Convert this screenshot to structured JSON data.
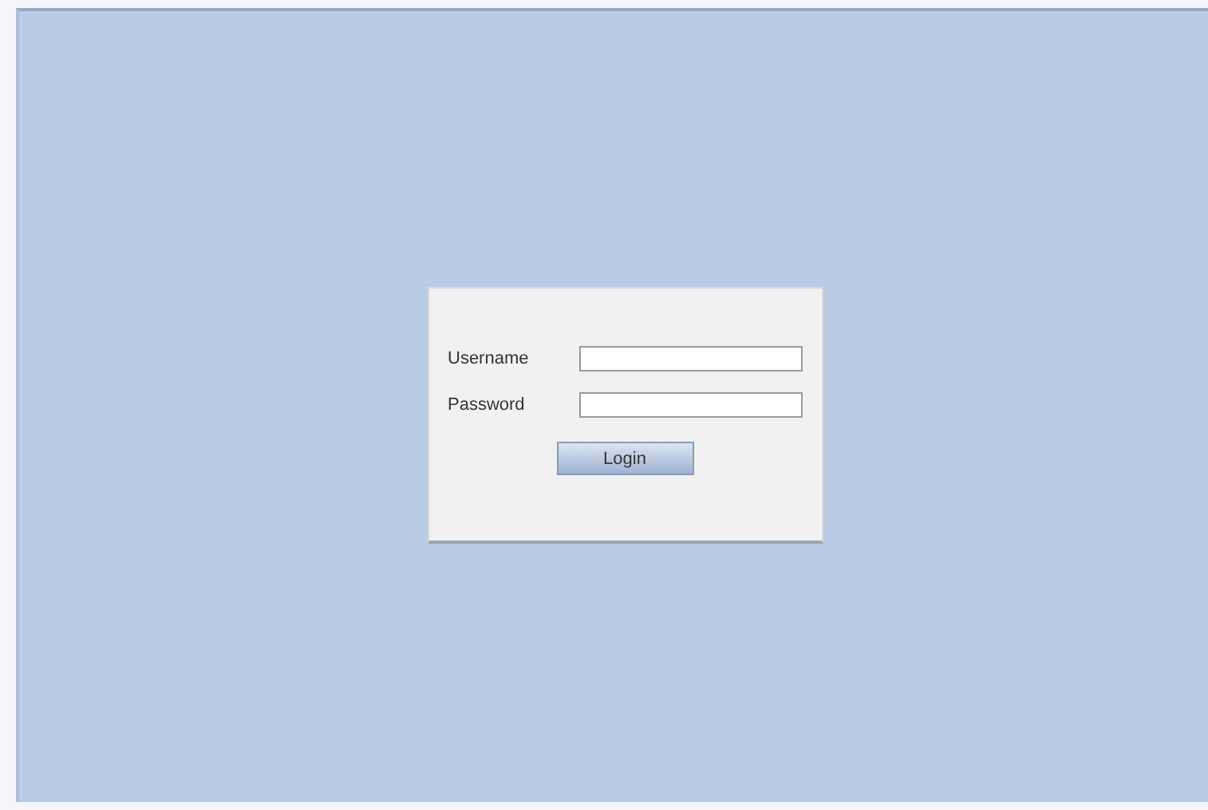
{
  "login": {
    "fields": [
      {
        "label": "Username"
      },
      {
        "label": "Password"
      }
    ],
    "button": "Login"
  }
}
